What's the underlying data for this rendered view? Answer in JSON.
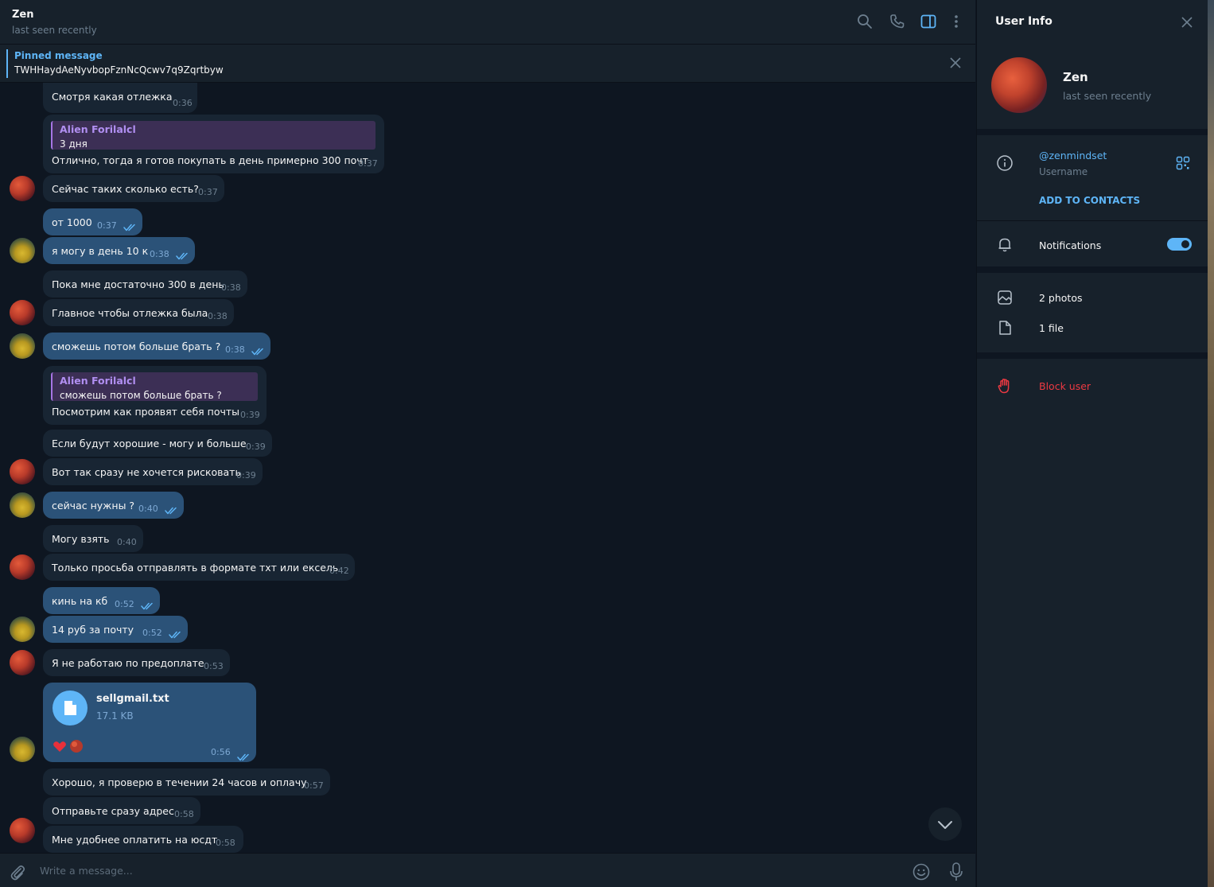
{
  "chat": {
    "title": "Zen",
    "status": "last seen recently",
    "pinned_title": "Pinned message",
    "pinned_text": "TWHHaydAeNyvbopFznNcQcwv7q9Zqrtbyw",
    "composer_placeholder": "Write a message..."
  },
  "messages": [
    {
      "id": "m1",
      "dir": "in",
      "text": "Смотря какая отлежка",
      "time": "0:36"
    },
    {
      "id": "m2",
      "dir": "in",
      "reply_name": "Alien Forilalcl",
      "reply_text": "3 дня",
      "text": "Отлично, тогда я готов покупать в день примерно 300 почт",
      "time": "0:37"
    },
    {
      "id": "m3",
      "dir": "in",
      "text": "Сейчас таких сколько есть?",
      "time": "0:37"
    },
    {
      "id": "m4",
      "dir": "out",
      "text": "от 1000",
      "time": "0:37"
    },
    {
      "id": "m5",
      "dir": "out",
      "text": "я могу в день 10 к",
      "time": "0:38"
    },
    {
      "id": "m6",
      "dir": "in",
      "text": "Пока мне достаточно 300 в день",
      "time": "0:38"
    },
    {
      "id": "m7",
      "dir": "in",
      "text": "Главное чтобы отлежка была",
      "time": "0:38"
    },
    {
      "id": "m8",
      "dir": "out",
      "text": "сможешь потом больше брать ?",
      "time": "0:38"
    },
    {
      "id": "m9",
      "dir": "in",
      "reply_name": "Alien Forilalcl",
      "reply_text": "сможешь потом больше брать ?",
      "text": "Посмотрим как проявят себя почты",
      "time": "0:39"
    },
    {
      "id": "m10",
      "dir": "in",
      "text": "Если будут хорошие - могу и больше",
      "time": "0:39"
    },
    {
      "id": "m11",
      "dir": "in",
      "text": "Вот так сразу не хочется рисковать",
      "time": "0:39"
    },
    {
      "id": "m12",
      "dir": "out",
      "text": "сейчас нужны ?",
      "time": "0:40"
    },
    {
      "id": "m13",
      "dir": "in",
      "text": "Могу взять",
      "time": "0:40"
    },
    {
      "id": "m14",
      "dir": "in",
      "text": "Только просьба отправлять в формате тхт или ексель",
      "time": "0:42"
    },
    {
      "id": "m15",
      "dir": "out",
      "text": "кинь на кб",
      "time": "0:52"
    },
    {
      "id": "m16",
      "dir": "out",
      "text": "14  руб за  почту",
      "time": "0:52"
    },
    {
      "id": "m17",
      "dir": "in",
      "text": "Я не работаю по предоплате",
      "time": "0:53"
    },
    {
      "id": "m19",
      "dir": "in",
      "text": "Хорошо, я проверю в течении 24 часов и оплачу",
      "time": "0:57"
    },
    {
      "id": "m20",
      "dir": "in",
      "text": "Отправьте сразу адрес",
      "time": "0:58"
    },
    {
      "id": "m21",
      "dir": "in",
      "text": "Мне удобнее оплатить на юсдт",
      "time": "0:58"
    }
  ],
  "file_message": {
    "name": "sellgmail.txt",
    "size": "17.1 KB",
    "time": "0:56",
    "reaction": "heart-icon"
  },
  "side": {
    "title": "User Info",
    "name": "Zen",
    "status": "last seen recently",
    "username": "@zenmindset",
    "username_label": "Username",
    "add_contacts": "ADD TO CONTACTS",
    "notifications": "Notifications",
    "notifications_on": true,
    "photos": "2 photos",
    "files": "1 file",
    "block": "Block user"
  },
  "colors": {
    "bg": "#0e1621",
    "panel": "#17212b",
    "incoming": "#182533",
    "outgoing": "#2b5278",
    "accent": "#5eb5f7",
    "reply": "#b18ff2",
    "danger": "#ec3942"
  }
}
